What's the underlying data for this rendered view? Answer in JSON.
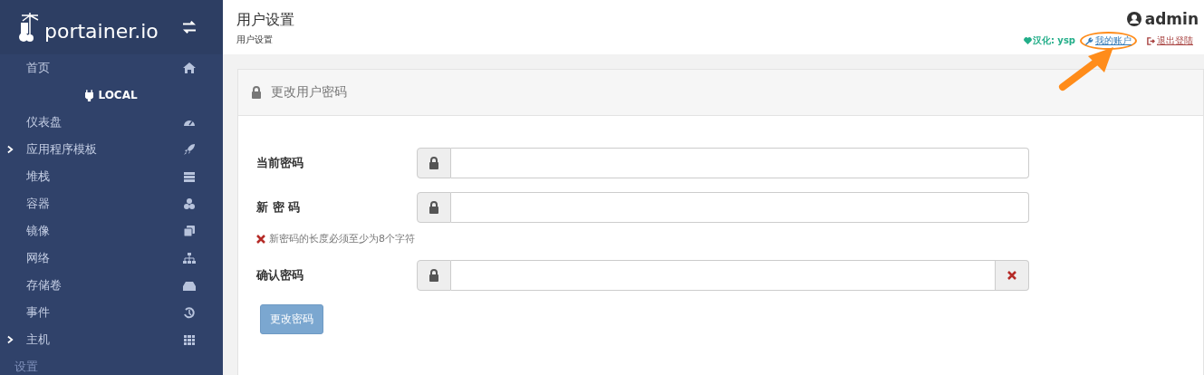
{
  "sidebar": {
    "logo": "portainer.io",
    "items": [
      {
        "kind": "item",
        "label": "首页",
        "expandable": false
      },
      {
        "kind": "endpoint",
        "label": "LOCAL"
      },
      {
        "kind": "item",
        "label": "仪表盘",
        "expandable": false
      },
      {
        "kind": "item",
        "label": "应用程序模板",
        "expandable": true
      },
      {
        "kind": "item",
        "label": "堆栈",
        "expandable": false
      },
      {
        "kind": "item",
        "label": "容器",
        "expandable": false
      },
      {
        "kind": "item",
        "label": "镜像",
        "expandable": false
      },
      {
        "kind": "item",
        "label": "网络",
        "expandable": false
      },
      {
        "kind": "item",
        "label": "存储卷",
        "expandable": false
      },
      {
        "kind": "item",
        "label": "事件",
        "expandable": false
      },
      {
        "kind": "item",
        "label": "主机",
        "expandable": true
      },
      {
        "kind": "heading",
        "label": "设置"
      }
    ]
  },
  "header": {
    "title": "用户设置",
    "breadcrumb": "用户设置",
    "user": "admin",
    "links": [
      {
        "kind": "credit",
        "label": "汉化: ysp"
      },
      {
        "kind": "account",
        "label": "我的账户",
        "highlighted": true
      },
      {
        "kind": "logout",
        "label": "退出登陆",
        "highlighted": false
      }
    ]
  },
  "panel": {
    "title": "更改用户密码",
    "fields": [
      {
        "label": "当前密码",
        "invalid": false
      },
      {
        "label": "新 密 码",
        "invalid": false,
        "error": "新密码的长度必须至少为8个字符"
      },
      {
        "label": "确认密码",
        "invalid": true
      }
    ],
    "button": {
      "label": "更改密码",
      "disabled": true
    }
  }
}
